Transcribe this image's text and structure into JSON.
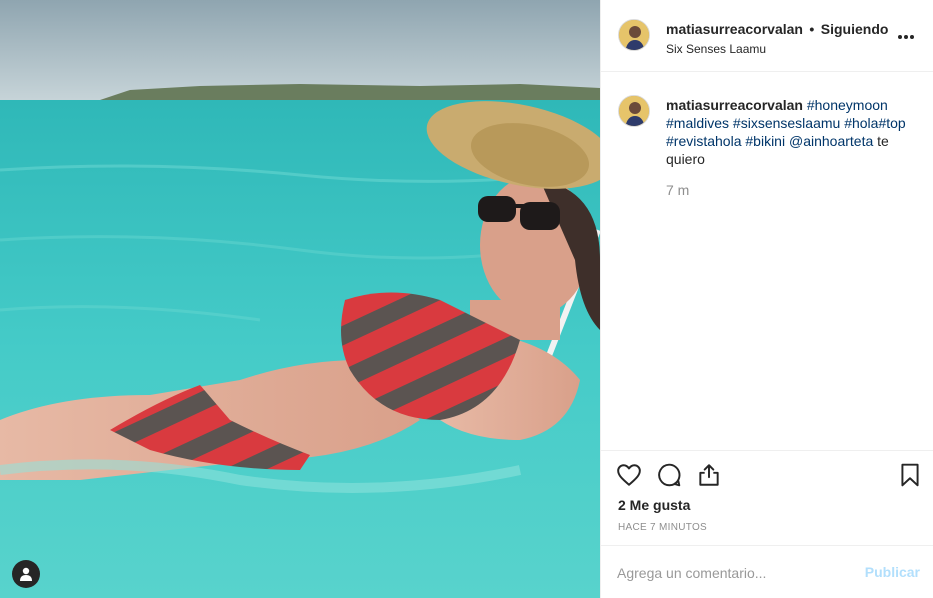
{
  "post": {
    "username": "matiasurreacorvalan",
    "separator": "•",
    "follow_label": "Siguiendo",
    "location": "Six Senses Laamu",
    "more_icon": "more-horizontal-icon"
  },
  "caption": {
    "username": "matiasurreacorvalan",
    "tags": [
      "#honeymoon",
      "#maldives",
      "#sixsenseslaamu",
      "#hola",
      "#top",
      "#revistahola",
      "#bikini",
      "@ainhoarteta"
    ],
    "text_tail": "te quiero",
    "time": "7 m"
  },
  "actions": {
    "like_icon": "heart-icon",
    "comment_icon": "comment-icon",
    "share_icon": "share-icon",
    "save_icon": "bookmark-icon"
  },
  "likes_label": "2 Me gusta",
  "time_ago": "HACE 7 MINUTOS",
  "comment": {
    "placeholder": "Agrega un comentario...",
    "value": "",
    "post_label": "Publicar"
  },
  "colors": {
    "link_blue": "#003569",
    "post_disabled": "#b2dffc",
    "water": "#3fc7c6"
  }
}
